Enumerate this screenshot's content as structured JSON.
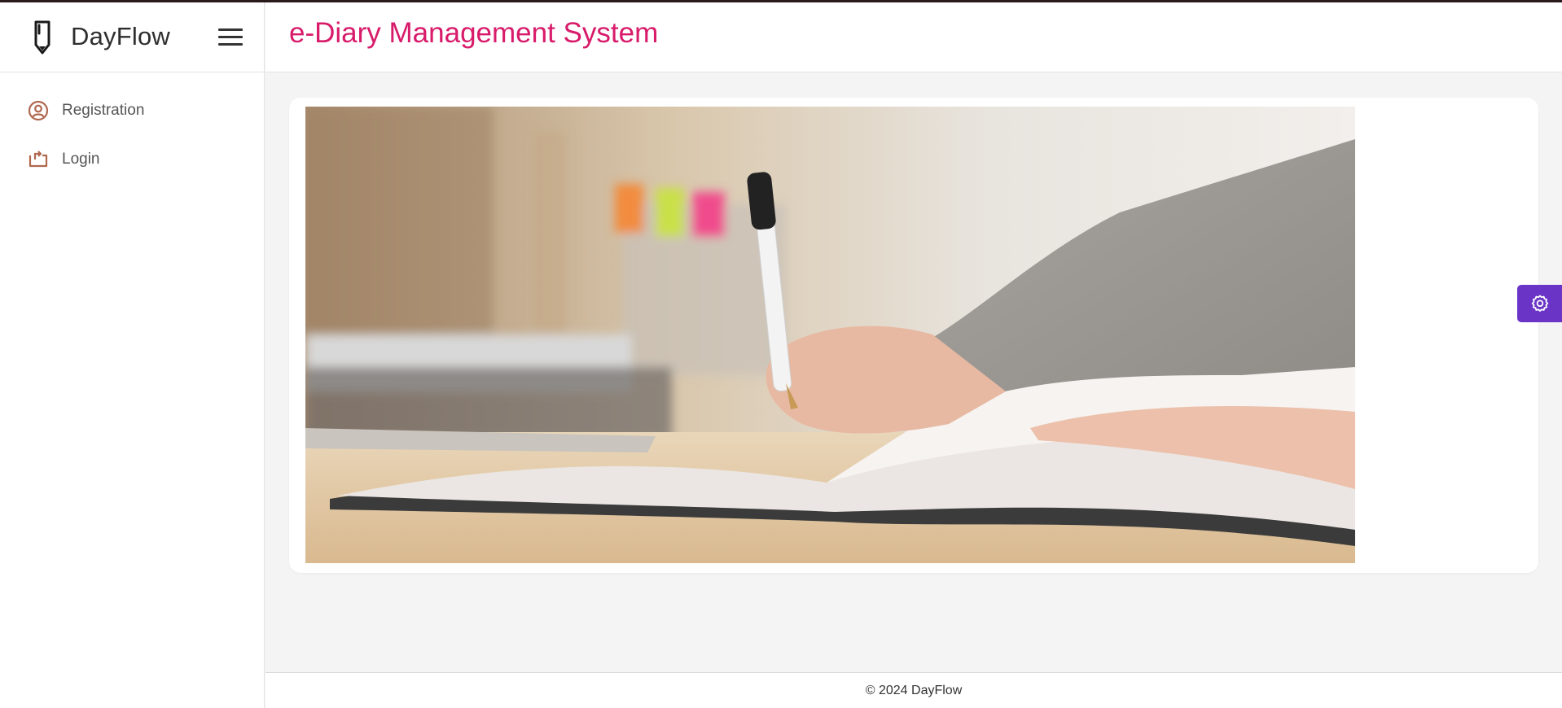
{
  "brand": {
    "name": "DayFlow",
    "icon": "pencil-icon"
  },
  "header": {
    "title": "e-Diary Management System"
  },
  "sidebar": {
    "items": [
      {
        "label": "Registration",
        "icon": "user-circle-icon"
      },
      {
        "label": "Login",
        "icon": "login-icon"
      }
    ]
  },
  "hero": {
    "image": "hand writing in notebook with pen"
  },
  "footer": {
    "text": "© 2024 DayFlow"
  },
  "colors": {
    "title": "#d81b6a",
    "nav_icon": "#b0684f",
    "settings_button": "#6a35c7"
  }
}
